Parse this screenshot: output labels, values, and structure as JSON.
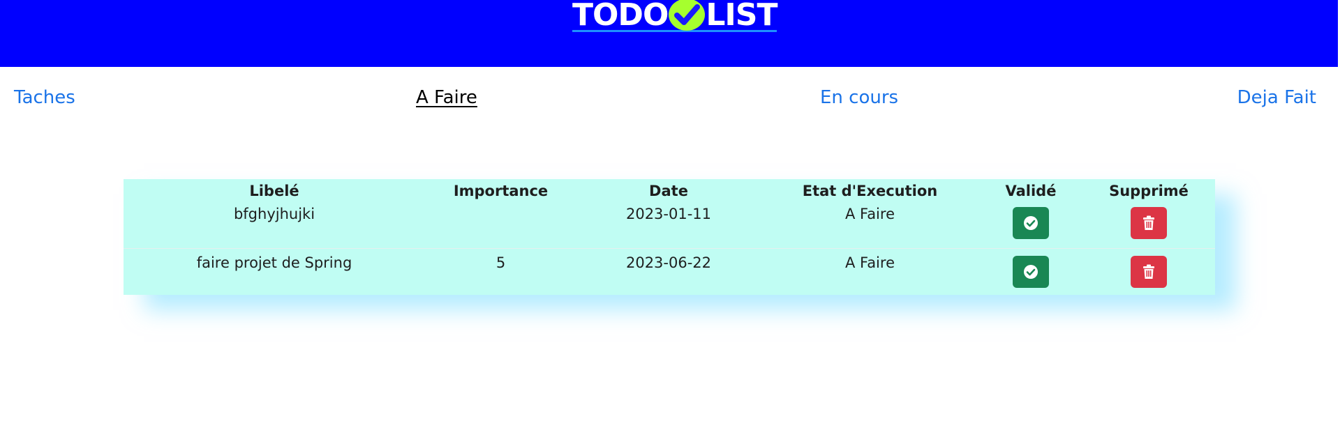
{
  "header": {
    "logo_left": "TODO",
    "logo_right": "LIST",
    "logo_icon": "check-circle-icon"
  },
  "nav": {
    "items": [
      {
        "label": "Taches"
      },
      {
        "label": "A Faire"
      },
      {
        "label": "En cours"
      },
      {
        "label": "Deja Fait"
      }
    ],
    "active": "A Faire"
  },
  "table": {
    "headers": [
      "Libelé",
      "Importance",
      "Date",
      "Etat d'Execution",
      "Validé",
      "Supprimé"
    ],
    "rows": [
      {
        "libele": "bfghyjhujki",
        "importance": "",
        "date": "2023-01-11",
        "etat": "A Faire",
        "valid_icon": "check-circle-icon",
        "delete_icon": "trash-icon"
      },
      {
        "libele": "faire projet de Spring",
        "importance": "5",
        "date": "2023-06-22",
        "etat": "A Faire",
        "valid_icon": "check-circle-icon",
        "delete_icon": "trash-icon"
      }
    ]
  },
  "colors": {
    "header_bg": "#0000ff",
    "logo_check_bg": "#a6ff2e",
    "nav_link": "#1a73e8",
    "table_bg": "#c0fdf3",
    "valid_button": "#198754",
    "delete_button": "#dc3545"
  }
}
